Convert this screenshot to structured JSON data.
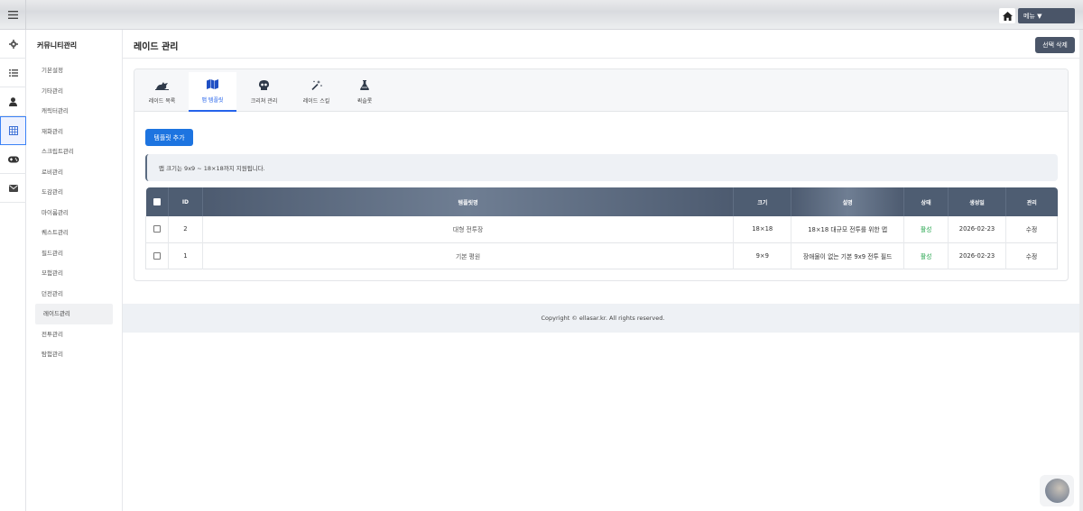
{
  "topbar": {
    "menu_label": "메뉴 ▼"
  },
  "rail": {
    "icons": [
      "gear-icon",
      "list-icon",
      "user-icon",
      "grid-icon",
      "gamepad-icon",
      "mail-icon"
    ]
  },
  "submenu": {
    "title": "커뮤니티관리",
    "items": [
      "기본설정",
      "기타관리",
      "캐릭터관리",
      "재화관리",
      "스크립트관리",
      "로비관리",
      "도감관리",
      "마이룸관리",
      "퀘스트관리",
      "필드관리",
      "모험관리",
      "던전관리",
      "레이드관리",
      "전투관리",
      "탐험관리"
    ],
    "active_index": 12
  },
  "header": {
    "title": "레이드 관리",
    "delete_label": "선택 삭제"
  },
  "tabs": [
    {
      "label": "레이드 목록",
      "icon": "dragon-icon"
    },
    {
      "label": "맵 템플릿",
      "icon": "map-icon"
    },
    {
      "label": "크리쳐 관리",
      "icon": "skull-icon"
    },
    {
      "label": "레이드 스킬",
      "icon": "wand-icon"
    },
    {
      "label": "퀵슬롯",
      "icon": "flask-icon"
    }
  ],
  "active_tab": 1,
  "add_button": "템플릿 추가",
  "info": "맵 크기는 9x9 ~ 18×18까지 지원됩니다.",
  "table": {
    "headers": [
      "ID",
      "템플릿명",
      "크기",
      "설명",
      "상태",
      "생성일",
      "관리"
    ],
    "rows": [
      {
        "id": "2",
        "name": "대형 전투장",
        "size": "18×18",
        "desc": "18×18 대규모 전투를 위한 맵",
        "status": "활성",
        "date": "2026-02-23",
        "action": "수정"
      },
      {
        "id": "1",
        "name": "기본 평원",
        "size": "9×9",
        "desc": "장애물이 없는 기본 9x9 전투 필드",
        "status": "활성",
        "date": "2026-02-23",
        "action": "수정"
      }
    ]
  },
  "footer": "Copyright © ellasar.kr. All rights reserved.",
  "colors": {
    "primary": "#1d74e0",
    "dark_button": "#4a5568",
    "table_header": "#4e5d72",
    "status_active": "#22a34a"
  }
}
